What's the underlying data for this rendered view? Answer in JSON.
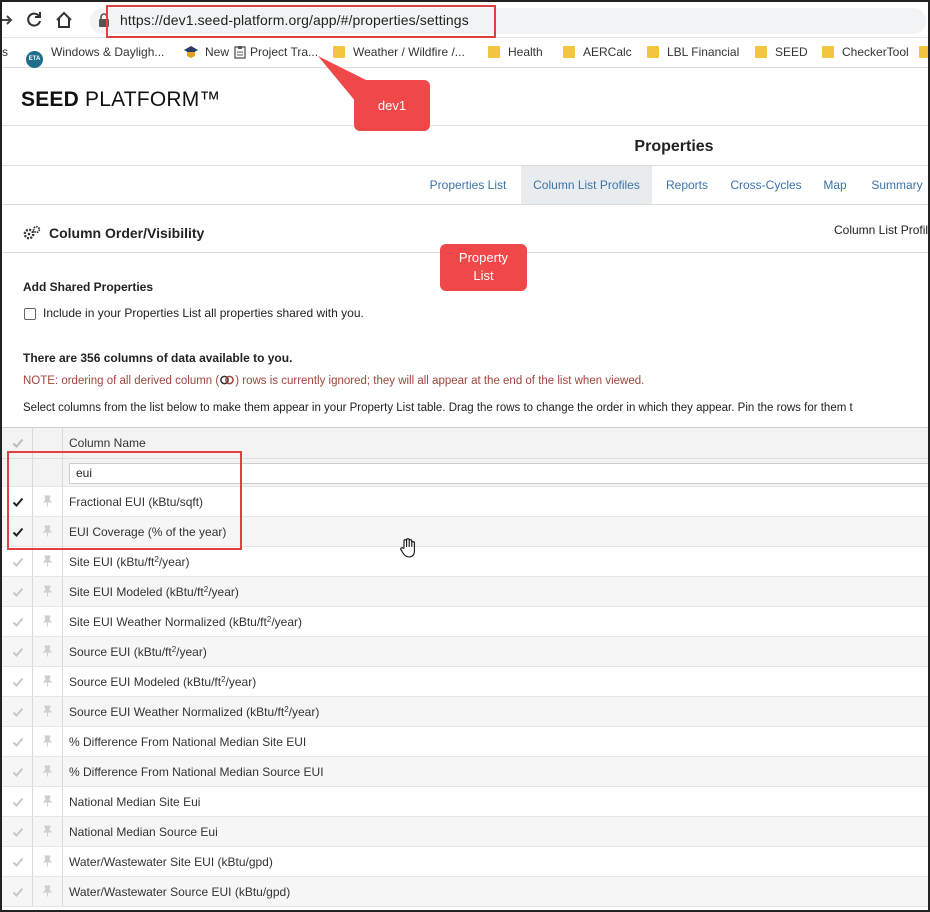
{
  "browser": {
    "url": "https://dev1.seed-platform.org/app/#/properties/settings",
    "bookmarks": [
      {
        "label": "s",
        "icon": "apps-icon"
      },
      {
        "label": "Windows & Dayligh...",
        "icon": "eta-icon"
      },
      {
        "label": "New",
        "icon": "graduation-cap-icon"
      },
      {
        "label": "Project Tra...",
        "icon": "clipboard-icon"
      },
      {
        "label": "Weather / Wildfire /...",
        "icon": "folder-icon"
      },
      {
        "label": "Health",
        "icon": "folder-icon"
      },
      {
        "label": "AERCalc",
        "icon": "folder-icon"
      },
      {
        "label": "LBL Financial",
        "icon": "folder-icon"
      },
      {
        "label": "SEED",
        "icon": "folder-icon"
      },
      {
        "label": "CheckerTool",
        "icon": "folder-icon"
      }
    ],
    "eta_badge": "ETA"
  },
  "app": {
    "logo_bold": "SEED",
    "logo_rest": " PLATFORM™",
    "page_title": "Properties",
    "tabs": [
      {
        "label": "Properties List",
        "active": false
      },
      {
        "label": "Column List Profiles",
        "active": true
      },
      {
        "label": "Reports",
        "active": false
      },
      {
        "label": "Cross-Cycles",
        "active": false
      },
      {
        "label": "Map",
        "active": false
      },
      {
        "label": "Summary",
        "active": false
      }
    ]
  },
  "section": {
    "title": "Column Order/Visibility",
    "right_label": "Column List Profil",
    "shared_heading": "Add Shared Properties",
    "shared_checkbox_label": "Include in your Properties List all properties shared with you.",
    "shared_checked": false,
    "count_text": "There are 356 columns of data available to you.",
    "note_before": "NOTE: ordering of all derived column (",
    "note_after": ") rows is currently ignored; they will all appear at the end of the list when viewed.",
    "instructions": "Select columns from the list below to make them appear in your Property List table. Drag the rows to change the order in which they appear. Pin the rows for them t"
  },
  "grid": {
    "column_header": "Column Name",
    "filter_value": "eui",
    "rows": [
      {
        "name": "Fractional EUI (kBtu/sqft)",
        "sup": "",
        "tail": "",
        "selected": true
      },
      {
        "name": "EUI Coverage (% of the year)",
        "sup": "",
        "tail": "",
        "selected": true
      },
      {
        "name": "Site EUI (kBtu/ft",
        "sup": "2",
        "tail": "/year)",
        "selected": false
      },
      {
        "name": "Site EUI Modeled (kBtu/ft",
        "sup": "2",
        "tail": "/year)",
        "selected": false
      },
      {
        "name": "Site EUI Weather Normalized (kBtu/ft",
        "sup": "2",
        "tail": "/year)",
        "selected": false
      },
      {
        "name": "Source EUI (kBtu/ft",
        "sup": "2",
        "tail": "/year)",
        "selected": false
      },
      {
        "name": "Source EUI Modeled (kBtu/ft",
        "sup": "2",
        "tail": "/year)",
        "selected": false
      },
      {
        "name": "Source EUI Weather Normalized (kBtu/ft",
        "sup": "2",
        "tail": "/year)",
        "selected": false
      },
      {
        "name": "% Difference From National Median Site EUI",
        "sup": "",
        "tail": "",
        "selected": false
      },
      {
        "name": "% Difference From National Median Source EUI",
        "sup": "",
        "tail": "",
        "selected": false
      },
      {
        "name": "National Median Site Eui",
        "sup": "",
        "tail": "",
        "selected": false
      },
      {
        "name": "National Median Source Eui",
        "sup": "",
        "tail": "",
        "selected": false
      },
      {
        "name": "Water/Wastewater Site EUI (kBtu/gpd)",
        "sup": "",
        "tail": "",
        "selected": false
      },
      {
        "name": "Water/Wastewater Source EUI (kBtu/gpd)",
        "sup": "",
        "tail": "",
        "selected": false
      }
    ]
  },
  "annotations": {
    "callout_dev1": "dev1",
    "callout_list_line1": "Property",
    "callout_list_line2": "List"
  },
  "colors": {
    "accent_link": "#3a74a8",
    "note_red": "#a0453a",
    "annotation_red": "#e04040"
  }
}
